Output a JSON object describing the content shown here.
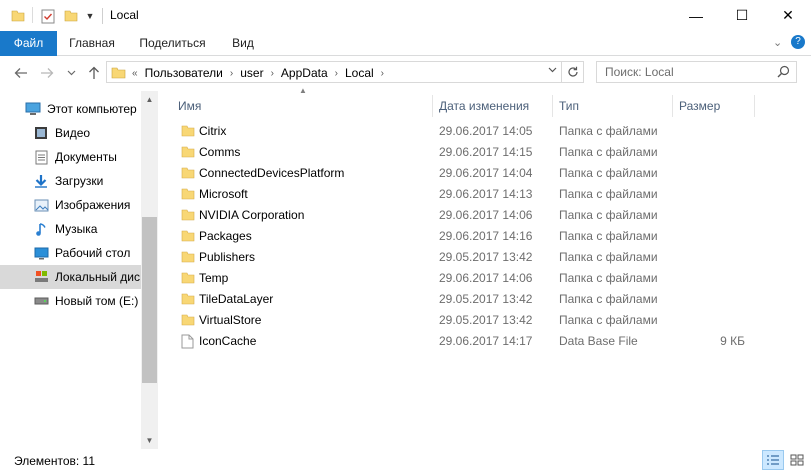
{
  "window": {
    "title": "Local",
    "controls": {
      "minimize": "—",
      "maximize": "☐",
      "close": "✕"
    }
  },
  "ribbon": {
    "tabs": [
      "Файл",
      "Главная",
      "Поделиться",
      "Вид"
    ],
    "collapse_glyph": "⌄",
    "help_glyph": "?"
  },
  "address": {
    "overflow": "«",
    "breadcrumbs": [
      "Пользователи",
      "user",
      "AppData",
      "Local"
    ],
    "separator": "›"
  },
  "search": {
    "placeholder": "Поиск: Local"
  },
  "nav_pane": {
    "items": [
      {
        "label": "Этот компьютер",
        "icon": "computer-icon"
      },
      {
        "label": "Видео",
        "icon": "video-icon"
      },
      {
        "label": "Документы",
        "icon": "documents-icon"
      },
      {
        "label": "Загрузки",
        "icon": "downloads-icon"
      },
      {
        "label": "Изображения",
        "icon": "pictures-icon"
      },
      {
        "label": "Музыка",
        "icon": "music-icon"
      },
      {
        "label": "Рабочий стол",
        "icon": "desktop-icon"
      },
      {
        "label": "Локальный дис",
        "icon": "local-disk-icon",
        "selected": true
      },
      {
        "label": "Новый том (E:)",
        "icon": "drive-icon"
      }
    ]
  },
  "file_list": {
    "columns": {
      "name": "Имя",
      "date": "Дата изменения",
      "type": "Тип",
      "size": "Размер"
    },
    "rows": [
      {
        "name": "Citrix",
        "date": "29.06.2017 14:05",
        "type": "Папка с файлами",
        "size": "",
        "kind": "folder"
      },
      {
        "name": "Comms",
        "date": "29.06.2017 14:15",
        "type": "Папка с файлами",
        "size": "",
        "kind": "folder"
      },
      {
        "name": "ConnectedDevicesPlatform",
        "date": "29.06.2017 14:04",
        "type": "Папка с файлами",
        "size": "",
        "kind": "folder"
      },
      {
        "name": "Microsoft",
        "date": "29.06.2017 14:13",
        "type": "Папка с файлами",
        "size": "",
        "kind": "folder"
      },
      {
        "name": "NVIDIA Corporation",
        "date": "29.06.2017 14:06",
        "type": "Папка с файлами",
        "size": "",
        "kind": "folder"
      },
      {
        "name": "Packages",
        "date": "29.06.2017 14:16",
        "type": "Папка с файлами",
        "size": "",
        "kind": "folder"
      },
      {
        "name": "Publishers",
        "date": "29.05.2017 13:42",
        "type": "Папка с файлами",
        "size": "",
        "kind": "folder"
      },
      {
        "name": "Temp",
        "date": "29.06.2017 14:06",
        "type": "Папка с файлами",
        "size": "",
        "kind": "folder"
      },
      {
        "name": "TileDataLayer",
        "date": "29.05.2017 13:42",
        "type": "Папка с файлами",
        "size": "",
        "kind": "folder"
      },
      {
        "name": "VirtualStore",
        "date": "29.05.2017 13:42",
        "type": "Папка с файлами",
        "size": "",
        "kind": "folder"
      },
      {
        "name": "IconCache",
        "date": "29.06.2017 14:17",
        "type": "Data Base File",
        "size": "9 КБ",
        "kind": "file"
      }
    ]
  },
  "status": {
    "items_label": "Элементов: 11"
  },
  "colors": {
    "file_tab": "#1979ca",
    "folder": "#f8d775",
    "selection": "#d9d9d9",
    "header_text": "#4c607a",
    "detail_text": "#6d6d6d"
  }
}
